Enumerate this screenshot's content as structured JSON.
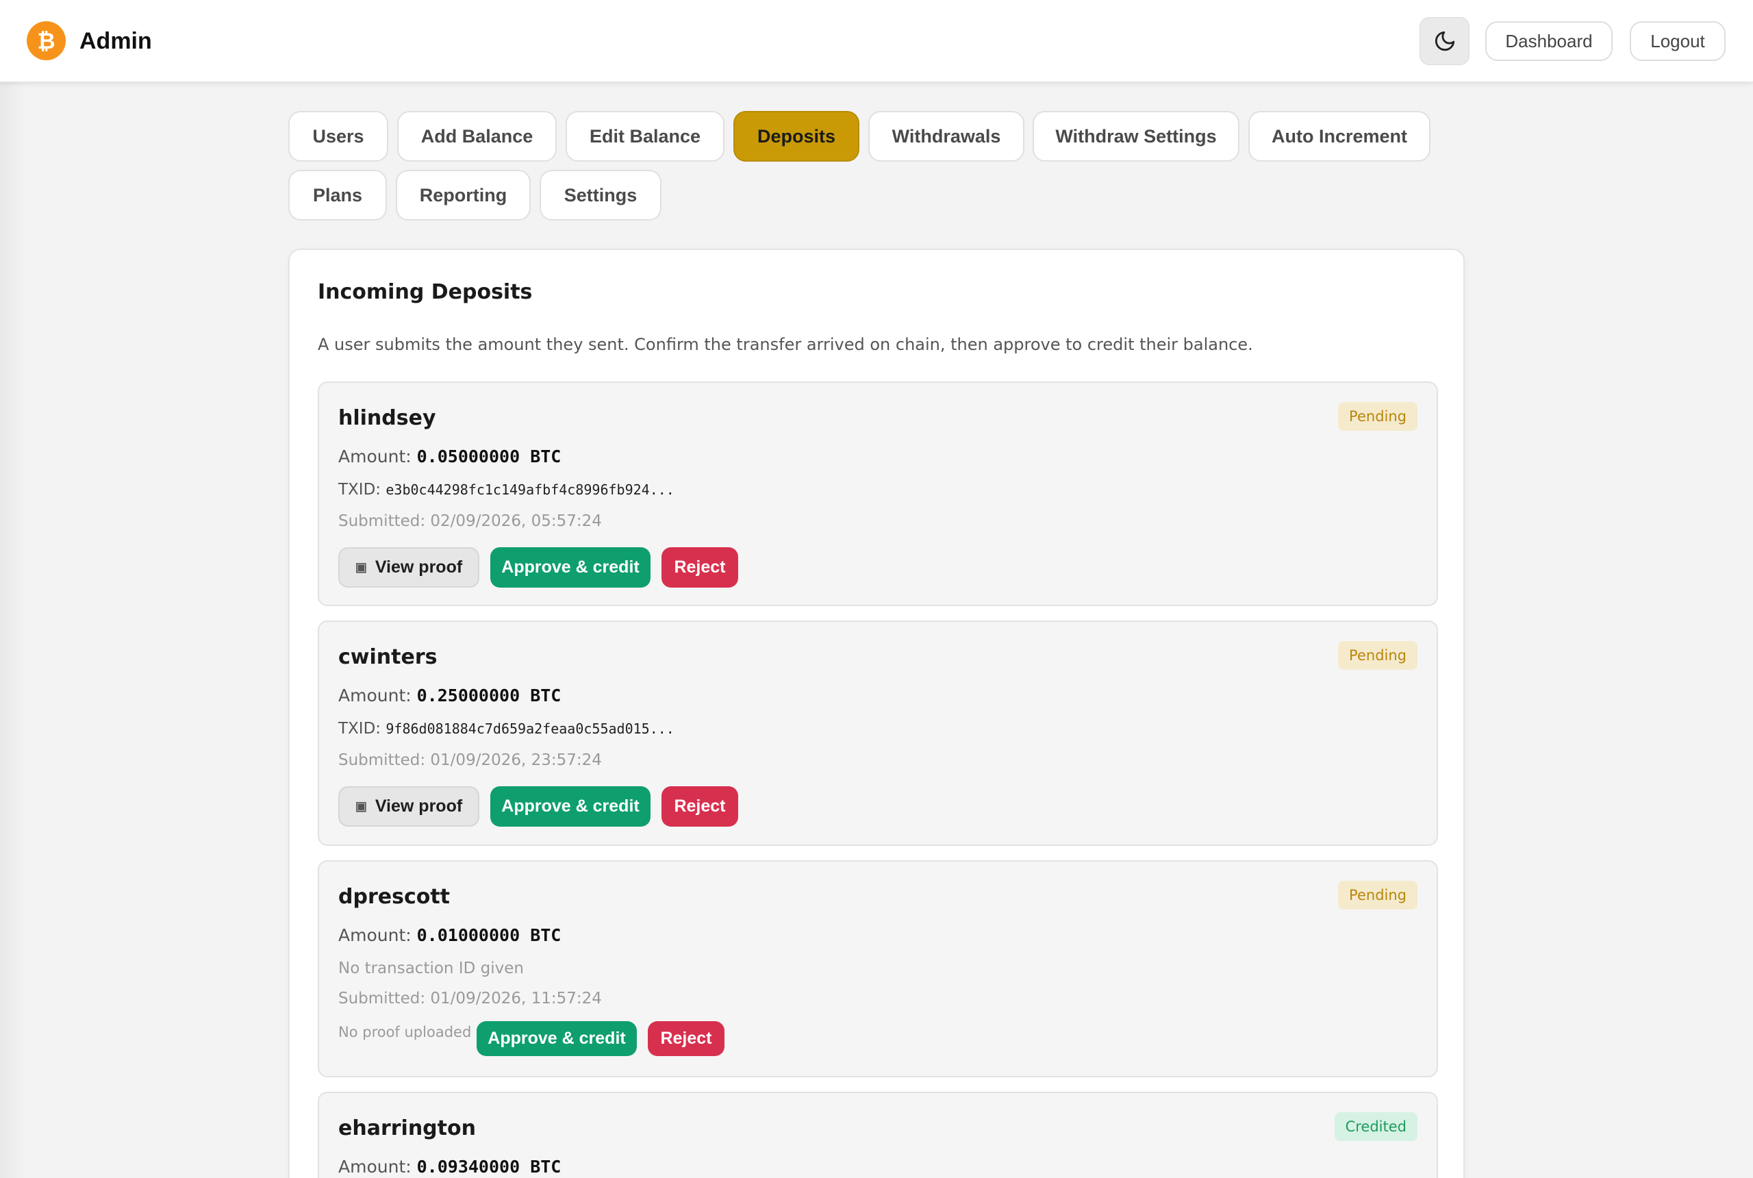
{
  "header": {
    "title": "Admin",
    "logo_symbol": "₿",
    "logo_icon": "bitcoin-logo-icon",
    "theme_icon": "moon-icon",
    "dashboard_label": "Dashboard",
    "logout_label": "Logout",
    "accent_color": "#f7931a"
  },
  "tabs": [
    {
      "label": "Users",
      "active": false
    },
    {
      "label": "Add Balance",
      "active": false
    },
    {
      "label": "Edit Balance",
      "active": false
    },
    {
      "label": "Deposits",
      "active": true
    },
    {
      "label": "Withdrawals",
      "active": false
    },
    {
      "label": "Withdraw Settings",
      "active": false
    },
    {
      "label": "Auto Increment",
      "active": false
    },
    {
      "label": "Plans",
      "active": false
    },
    {
      "label": "Reporting",
      "active": false
    },
    {
      "label": "Settings",
      "active": false
    }
  ],
  "active_tab_color": "#c99a06",
  "panel": {
    "title": "Incoming Deposits",
    "description": "A user submits the amount they sent. Confirm the transfer arrived on chain, then approve to credit their balance."
  },
  "labels": {
    "amount": "Amount:",
    "txid": "TXID:",
    "view_proof": "View proof",
    "approve": "Approve & credit",
    "reject": "Reject",
    "camera_icon": "camera-icon"
  },
  "deposits": [
    {
      "username": "hlindsey",
      "status": "Pending",
      "amount": "0.05000000 BTC",
      "txid": "e3b0c44298fc1c149afbf4c8996fb924...",
      "submitted": "Submitted: 02/09/2026, 05:57:24"
    },
    {
      "username": "cwinters",
      "status": "Pending",
      "amount": "0.25000000 BTC",
      "txid": "9f86d081884c7d659a2feaa0c55ad015...",
      "submitted": "Submitted: 01/09/2026, 23:57:24"
    },
    {
      "username": "dprescott",
      "status": "Pending",
      "amount": "0.01000000 BTC",
      "no_txid": "No transaction ID given",
      "submitted": "Submitted: 01/09/2026, 11:57:24",
      "no_proof": "No proof uploaded"
    },
    {
      "username": "eharrington",
      "status": "Credited",
      "amount": "0.09340000 BTC"
    }
  ],
  "status_colors": {
    "pending": "#b8860b",
    "credited": "#1f9a5d",
    "approve": "#0f9f6e",
    "reject": "#d7304e"
  }
}
